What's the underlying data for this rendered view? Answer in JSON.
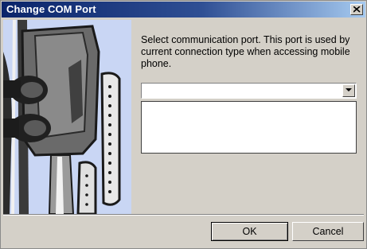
{
  "window": {
    "title": "Change COM Port"
  },
  "content": {
    "prompt": "Select communication port. This port is used by current connection type when accessing mobile phone.",
    "port_select": {
      "selected": ""
    },
    "port_list": []
  },
  "buttons": {
    "ok": "OK",
    "cancel": "Cancel"
  },
  "icons": {
    "close": "close-icon",
    "dropdown": "chevron-down-icon",
    "illustration": "serial-cable-connectors-illustration"
  },
  "colors": {
    "titlebar_start": "#0a246a",
    "titlebar_end": "#a6caf0",
    "dialog_bg": "#d4d0c8",
    "illustration_bg": "#c9d6f4"
  }
}
